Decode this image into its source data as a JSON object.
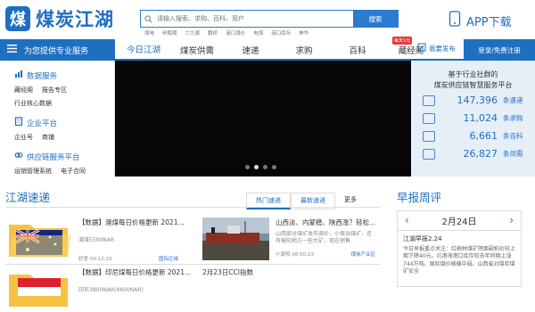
{
  "header": {
    "logo_mark": "煤",
    "logo_text": "煤炭江湖",
    "search_placeholder": "请输入搜索、求购、百科、用户",
    "search_button": "搜索",
    "hot_words": [
      "煤电",
      "甲醇期",
      "六九媒",
      "鹏桥",
      "港口煤价",
      "电煤",
      "港口库存",
      "神华"
    ],
    "app_download": "APP下载"
  },
  "nav": {
    "service_label": "为您提供专业服务",
    "tabs": [
      "今日江湖",
      "煤炭供需",
      "速递",
      "求购",
      "百科",
      "藏经阁"
    ],
    "active_tab": "今日江湖",
    "badge": "每天1元",
    "publish": "我要发布",
    "login": "登录/免费注册"
  },
  "menu": [
    {
      "title": "数据服务",
      "links": [
        "藏经阁",
        "报告专区",
        "行业核心数据"
      ]
    },
    {
      "title": "企业平台",
      "links": [
        "企业号",
        "商铺"
      ]
    },
    {
      "title": "供应链服务平台",
      "links": [
        "运销管理系统",
        "电子合同"
      ]
    }
  ],
  "stats": {
    "header_line1": "基于行业社群的",
    "header_line2": "煤炭供应链智慧服务平台",
    "items": [
      {
        "value": "147,396",
        "label": "条速递"
      },
      {
        "value": "11,024",
        "label": "条求购"
      },
      {
        "value": "6,661",
        "label": "条百科"
      },
      {
        "value": "26,827",
        "label": "条供需"
      }
    ]
  },
  "jianghu": {
    "title": "江湖速递",
    "tabs": [
      "热门速递",
      "最新速递",
      "更多"
    ],
    "active_tab": "热门速递",
    "cards": [
      {
        "title": "【数据】澳煤每日价格更新 2021...",
        "sub": "澳煤5500NAR",
        "author": "好意",
        "time": "09:12:23",
        "category": "国际区域"
      },
      {
        "title": "山西淡、内蒙稳、陕西涨？轻松...",
        "sub": "山西部分煤矿发布调价，小保当煤矿，还有榆阳地方一些大矿，现在销售",
        "author": "小黄鸭",
        "time": "08:50:23",
        "category": "煤炭产业区"
      },
      {
        "title": "【数据】印尼煤每日价格更新 2021...",
        "sub": "印尼3800NAR(4600NAR)",
        "author": "",
        "time": "",
        "category": ""
      },
      {
        "title": "2月23日CCI指数",
        "sub": "",
        "author": "",
        "time": "",
        "category": ""
      }
    ]
  },
  "brief": {
    "title": "早报周评",
    "date": "2月24日",
    "item_title": "江湖早报2.24",
    "item_text": "今日早报重点关注：红柳林煤矿降面副拍价较上期下降40元。坑港海港口库存较去年同期上涨744万吨。国际煤价格偏中弱。山西省对煤炭煤矿安全"
  }
}
